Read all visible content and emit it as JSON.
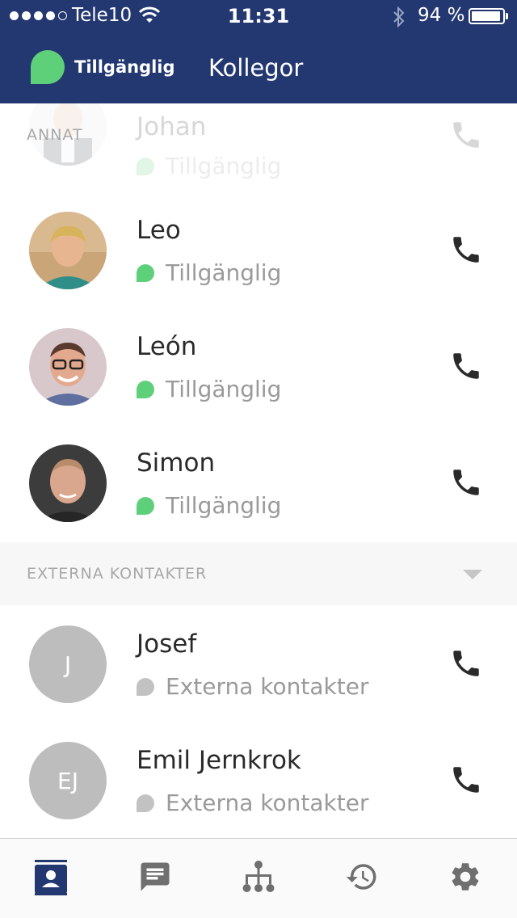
{
  "status_bar": {
    "carrier": "Tele10",
    "time": "11:31",
    "battery": "94 %",
    "battery_level": 0.94
  },
  "header": {
    "presence_label": "Tillgänglig",
    "title": "Kollegor"
  },
  "sections": {
    "annat_label": "ANNAT",
    "external_label": "EXTERNA KONTAKTER"
  },
  "contacts": [
    {
      "name": "Johan",
      "status": "Tillgänglig"
    },
    {
      "name": "Leo",
      "status": "Tillgänglig"
    },
    {
      "name": "León",
      "status": "Tillgänglig"
    },
    {
      "name": "Simon",
      "status": "Tillgänglig"
    }
  ],
  "external_contacts": [
    {
      "name": "Josef",
      "initials": "J",
      "status": "Externa kontakter"
    },
    {
      "name": "Emil Jernkrok",
      "initials": "EJ",
      "status": "Externa kontakter"
    }
  ],
  "colors": {
    "header_bg": "#233871",
    "available": "#5fd07a",
    "external": "#c2c2c2",
    "active_tab": "#233871",
    "inactive_tab": "#6f6f6f"
  },
  "tabs": [
    {
      "icon": "contacts-icon",
      "active": true
    },
    {
      "icon": "chat-icon",
      "active": false
    },
    {
      "icon": "org-chart-icon",
      "active": false
    },
    {
      "icon": "history-icon",
      "active": false
    },
    {
      "icon": "settings-icon",
      "active": false
    }
  ]
}
